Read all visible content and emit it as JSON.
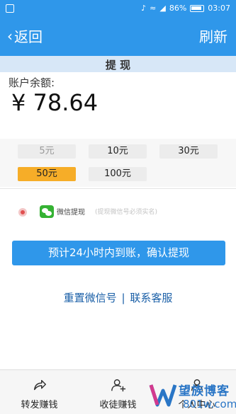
{
  "status_bar": {
    "battery": "86%",
    "time": "03:07"
  },
  "nav": {
    "back_label": "返回",
    "refresh_label": "刷新"
  },
  "section_title": "提 现",
  "balance": {
    "label": "账户余额:",
    "amount": "¥ 78.64"
  },
  "amounts": [
    {
      "label": "5元",
      "state": "disabled"
    },
    {
      "label": "10元",
      "state": "normal"
    },
    {
      "label": "30元",
      "state": "normal"
    },
    {
      "label": "50元",
      "state": "selected"
    },
    {
      "label": "100元",
      "state": "normal"
    }
  ],
  "payment": {
    "method": "微信提现",
    "hint": "(提现微信号必须实名)"
  },
  "confirm_label": "预计24小时内到账，确认提现",
  "links": {
    "reset_wechat": "重置微信号",
    "separator": "|",
    "contact": "联系客服"
  },
  "tabs": [
    {
      "label": "转发赚钱",
      "icon": "share-icon"
    },
    {
      "label": "收徒赚钱",
      "icon": "add-user-icon"
    },
    {
      "label": "个人中心",
      "icon": "user-icon"
    }
  ],
  "watermark": {
    "title": "望族博客",
    "url": "801w.com"
  },
  "colors": {
    "primary": "#2f97ea",
    "selected": "#f6ad28",
    "wechat": "#35b233",
    "link": "#1a5fa7"
  }
}
